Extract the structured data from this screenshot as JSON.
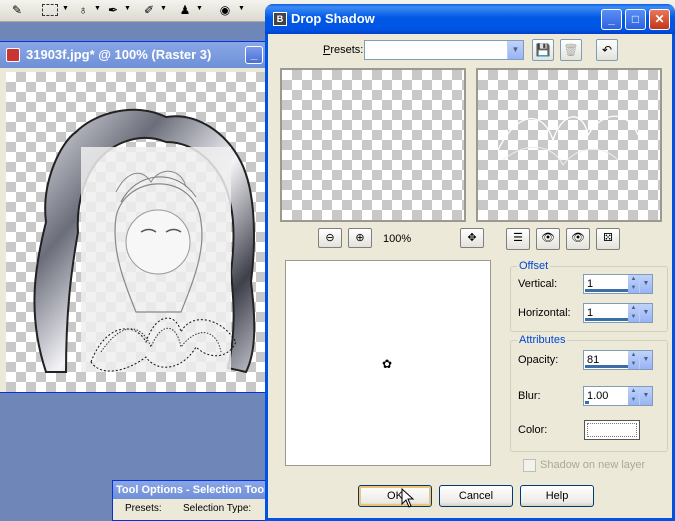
{
  "image_window": {
    "title": "31903f.jpg* @ 100% (Raster 3)",
    "minimize_label": "_"
  },
  "tool_options": {
    "title": "Tool Options - Selection Tool",
    "presets_label": "Presets:",
    "selection_type_label": "Selection Type:"
  },
  "dialog": {
    "title": "Drop Shadow",
    "presets_label": "Presets:",
    "zoom_label": "100%",
    "offset": {
      "group_title": "Offset",
      "vertical_label": "Vertical:",
      "vertical_value": "1",
      "horizontal_label": "Horizontal:",
      "horizontal_value": "1"
    },
    "attributes": {
      "group_title": "Attributes",
      "opacity_label": "Opacity:",
      "opacity_value": "81",
      "blur_label": "Blur:",
      "blur_value": "1.00",
      "color_label": "Color:",
      "shadow_new_layer_label": "Shadow on new layer"
    },
    "buttons": {
      "ok": "OK",
      "cancel": "Cancel",
      "help": "Help"
    }
  },
  "colors": {
    "dialog_title_blue": "#0054e3",
    "group_title_blue": "#0046d5",
    "shadow_color": "#ffffff"
  }
}
